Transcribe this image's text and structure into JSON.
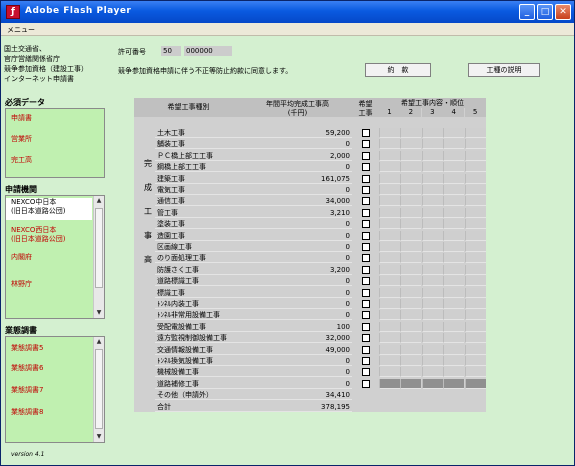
{
  "window": {
    "title": "Adobe Flash Player"
  },
  "menu": {
    "label": "メニュー"
  },
  "ministry": {
    "lines": [
      "国土交通省、",
      "官庁営繕関係省庁",
      "競争参加資格（建設工事）",
      "インターネット申請書"
    ]
  },
  "sidebar": {
    "required_title": "必須データ",
    "required_items": [
      "申請書",
      "営業所",
      "完工高"
    ],
    "agency_title": "申請機関",
    "agency_items": [
      "NEXCO中日本",
      "(旧日本道路公団)",
      "NEXCO西日本",
      "(旧日本道路公団)",
      "内閣府",
      "林野庁"
    ],
    "survey_title": "業態調書",
    "survey_items": [
      "業態調書5",
      "業態調書6",
      "業態調書7",
      "業態調書8"
    ],
    "version": "version 4.1"
  },
  "permit": {
    "label": "許可番号",
    "prefix": "50",
    "number": "000000"
  },
  "consent": {
    "text": "競争参加資格申請に伴う不正等防止約款に同意します。",
    "terms_button": "約　款",
    "explain_button": "工種の説明"
  },
  "table": {
    "headers": {
      "type": "希望工事種別",
      "avg1": "年間平均完成工事高",
      "avg2": "(千円)",
      "want1": "希望",
      "want2": "工事",
      "rank": "希望工事内容・順位"
    },
    "rank_cols": [
      "1",
      "2",
      "3",
      "4",
      "5"
    ],
    "side_label": [
      "完",
      "成",
      "工",
      "事",
      "高"
    ],
    "rows": [
      {
        "name": "土木工事",
        "value": "59,200"
      },
      {
        "name": "舗装工事",
        "value": "0"
      },
      {
        "name": "ＰＣ橋上部工工事",
        "value": "2,000"
      },
      {
        "name": "鋼橋上部工工事",
        "value": "0"
      },
      {
        "name": "建築工事",
        "value": "161,075"
      },
      {
        "name": "電気工事",
        "value": "0"
      },
      {
        "name": "通信工事",
        "value": "34,000"
      },
      {
        "name": "管工事",
        "value": "3,210"
      },
      {
        "name": "塗装工事",
        "value": "0"
      },
      {
        "name": "造園工事",
        "value": "0"
      },
      {
        "name": "区画線工事",
        "value": "0"
      },
      {
        "name": "のり面処理工事",
        "value": "0"
      },
      {
        "name": "防護さく工事",
        "value": "3,200"
      },
      {
        "name": "道路標識工事",
        "value": "0"
      },
      {
        "name": "標識工事",
        "value": "0"
      },
      {
        "name": "ﾄﾝﾈﾙ内装工事",
        "value": "0"
      },
      {
        "name": "ﾄﾝﾈﾙ非常用設備工事",
        "value": "0"
      },
      {
        "name": "受配電設備工事",
        "value": "100"
      },
      {
        "name": "遠方監視制御設備工事",
        "value": "32,000"
      },
      {
        "name": "交通情報設備工事",
        "value": "49,000"
      },
      {
        "name": "ﾄﾝﾈﾙ換気設備工事",
        "value": "0"
      },
      {
        "name": "機械設備工事",
        "value": "0"
      },
      {
        "name": "道路補修工事",
        "value": "0"
      },
      {
        "name": "その他（申請外）",
        "value": "34,410"
      },
      {
        "name": "合計",
        "value": "378,195"
      }
    ]
  }
}
